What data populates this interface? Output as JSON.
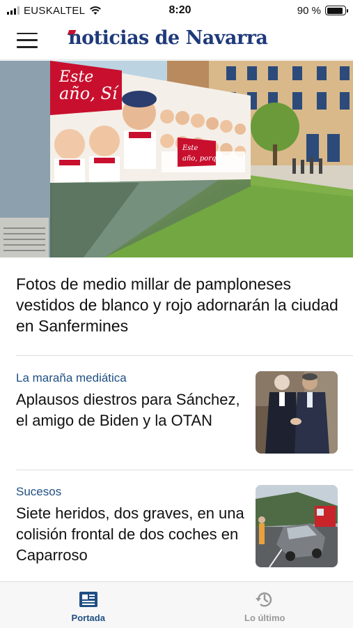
{
  "status_bar": {
    "carrier": "EUSKALTEL",
    "time": "8:20",
    "battery_text": "90 %",
    "battery_level": 0.9
  },
  "header": {
    "logo_text": "noticias de Navarra",
    "menu_icon": "hamburger-menu-icon"
  },
  "hero": {
    "banner_text_1": "Este",
    "banner_text_2": "año, Sí",
    "banner_small_1": "Este",
    "banner_small_2": "año, porque..."
  },
  "lead_story": {
    "title": "Fotos de medio millar de pamploneses vestidos de blanco y rojo adornarán la ciudad en Sanfermines"
  },
  "stories": [
    {
      "kicker": "La maraña mediática",
      "title": "Aplausos diestros para Sánchez, el amigo de Biden y la OTAN"
    },
    {
      "kicker": "Sucesos",
      "title": "Siete heridos, dos graves, en una colisión frontal de dos coches en Caparroso"
    }
  ],
  "tab_bar": {
    "tabs": [
      {
        "label": "Portada",
        "icon": "newspaper-icon",
        "active": true
      },
      {
        "label": "Lo último",
        "icon": "history-clock-icon",
        "active": false
      }
    ]
  },
  "colors": {
    "brand_blue": "#1f3a7a",
    "brand_red": "#c8102e",
    "kicker_blue": "#1f4f82"
  }
}
